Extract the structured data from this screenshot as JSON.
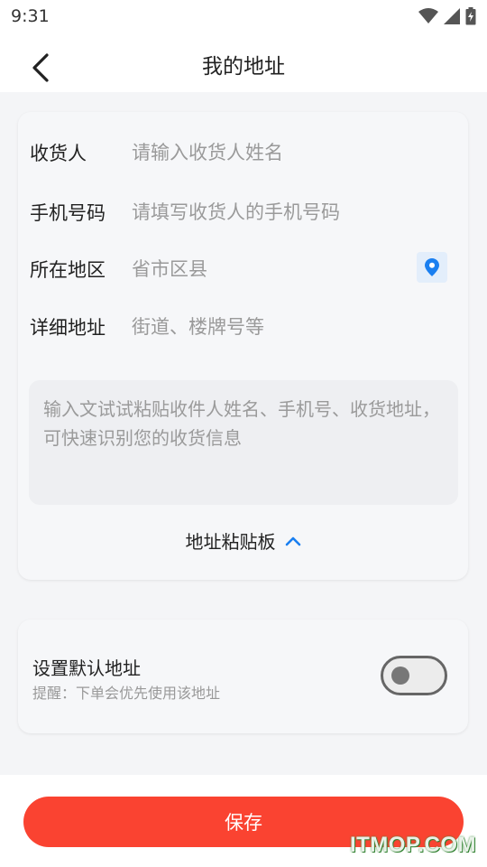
{
  "status_bar": {
    "time": "9:31"
  },
  "nav": {
    "title": "我的地址"
  },
  "form": {
    "fields": [
      {
        "label": "收货人",
        "placeholder": "请输入收货人姓名"
      },
      {
        "label": "手机号码",
        "placeholder": "请填写收货人的手机号码"
      },
      {
        "label": "所在地区",
        "placeholder": "省市区县"
      },
      {
        "label": "详细地址",
        "placeholder": "街道、楼牌号等"
      }
    ],
    "paste_placeholder": "输入文试试粘贴收件人姓名、手机号、收货地址，可快速识别您的收货信息",
    "paste_toggle_label": "地址粘贴板",
    "location_icon": "location-pin-icon",
    "accent_color": "#1a7ff0"
  },
  "default_address": {
    "title": "设置默认地址",
    "hint": "提醒：下单会优先使用该地址",
    "enabled": false
  },
  "save_button": {
    "label": "保存",
    "color": "#fa4331"
  },
  "watermark": "ITMOP.COM"
}
